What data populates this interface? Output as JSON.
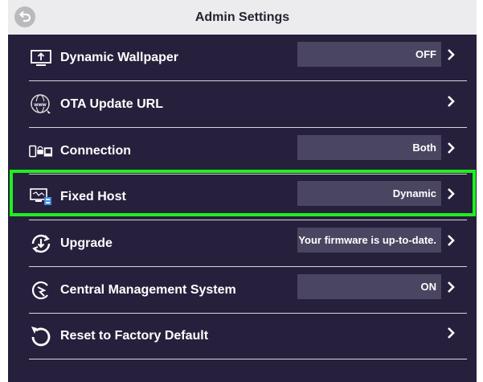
{
  "header": {
    "title": "Admin Settings",
    "back_icon": "back-arrow-icon"
  },
  "rows": [
    {
      "label": "Dynamic Wallpaper",
      "value": "OFF",
      "icon": "display-upload-icon"
    },
    {
      "label": "OTA Update URL",
      "value": "",
      "icon": "www-globe-icon"
    },
    {
      "label": "Connection",
      "value": "Both",
      "icon": "devices-connection-icon"
    },
    {
      "label": "Fixed Host",
      "value": "Dynamic",
      "icon": "host-monitor-icon"
    },
    {
      "label": "Upgrade",
      "value": "Your firmware is up-to-date.",
      "icon": "upgrade-refresh-icon"
    },
    {
      "label": "Central Management System",
      "value": "ON",
      "icon": "cms-logo-icon"
    },
    {
      "label": "Reset to Factory Default",
      "value": "",
      "icon": "reset-arrow-icon"
    }
  ],
  "highlighted_row": "Fixed Host",
  "colors": {
    "panel": "#27203c",
    "header": "#ececef",
    "value_box": "#4a4560",
    "highlight": "#1ef01e"
  }
}
